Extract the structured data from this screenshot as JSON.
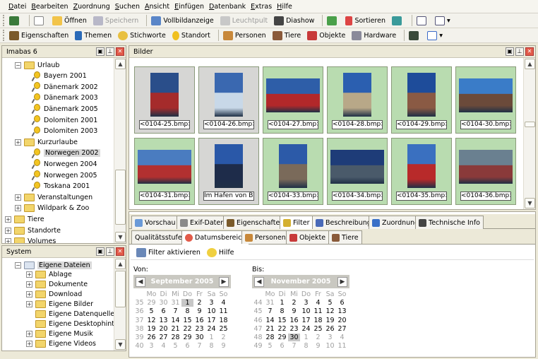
{
  "menu": [
    "Datei",
    "Bearbeiten",
    "Zuordnung",
    "Suchen",
    "Ansicht",
    "Einfügen",
    "Datenbank",
    "Extras",
    "Hilfe"
  ],
  "toolbar1": {
    "open": "Öffnen",
    "save": "Speichern",
    "fullscreen": "Vollbildanzeige",
    "lighttable": "Leuchtpult",
    "slideshow": "Diashow",
    "sort": "Sortieren"
  },
  "toolbar2": {
    "properties": "Eigenschaften",
    "topics": "Themen",
    "keywords": "Stichworte",
    "location": "Standort",
    "people": "Personen",
    "animals": "Tiere",
    "objects": "Objekte",
    "hardware": "Hardware"
  },
  "left_top": {
    "title": "Imabas 6",
    "items": [
      {
        "label": "Urlaub",
        "type": "folder",
        "expand": "−"
      },
      {
        "label": "Bayern 2001",
        "type": "pin"
      },
      {
        "label": "Dänemark 2002",
        "type": "pin"
      },
      {
        "label": "Dänemark 2003",
        "type": "pin"
      },
      {
        "label": "Dänemark 2005",
        "type": "pin"
      },
      {
        "label": "Dolomiten 2001",
        "type": "pin"
      },
      {
        "label": "Dolomiten 2003",
        "type": "pin"
      },
      {
        "label": "Kurzurlaube",
        "type": "folder",
        "expand": "+"
      },
      {
        "label": "Norwegen 2002",
        "type": "pin",
        "selected": true
      },
      {
        "label": "Norwegen 2004",
        "type": "pin"
      },
      {
        "label": "Norwegen 2005",
        "type": "pin"
      },
      {
        "label": "Toskana 2001",
        "type": "pin"
      },
      {
        "label": "Veranstaltungen",
        "type": "folder",
        "expand": "+"
      },
      {
        "label": "Wildpark & Zoo",
        "type": "folder",
        "expand": "+"
      },
      {
        "label": "Tiere",
        "type": "folder",
        "expand": "+"
      },
      {
        "label": "Standorte",
        "type": "folder",
        "expand": "+"
      },
      {
        "label": "Volumes",
        "type": "folder",
        "expand": "+"
      }
    ]
  },
  "left_bottom": {
    "title": "System",
    "items": [
      {
        "label": "Eigene Dateien",
        "expand": "−",
        "selected": true
      },
      {
        "label": "Ablage",
        "expand": "+"
      },
      {
        "label": "Dokumente",
        "expand": "+"
      },
      {
        "label": "Download",
        "expand": "+"
      },
      {
        "label": "Eigene Bilder",
        "expand": "+"
      },
      {
        "label": "Eigene Datenquellen",
        "expand": ""
      },
      {
        "label": "Eigene Desktophintergrü",
        "expand": ""
      },
      {
        "label": "Eigene Musik",
        "expand": "+"
      },
      {
        "label": "Eigene Videos",
        "expand": "+"
      }
    ]
  },
  "images": {
    "title": "Bilder",
    "tiles": [
      {
        "caption": "<0104-25.bmp>",
        "bg": "y",
        "shape": "portrait",
        "colors": [
          "#2a4e8a",
          "#a52b2b"
        ]
      },
      {
        "caption": "<0104-26.bmp>",
        "bg": "y",
        "shape": "portrait",
        "colors": [
          "#3a68b0",
          "#c8d8e8"
        ]
      },
      {
        "caption": "<0104-27.bmp>",
        "bg": "g",
        "shape": "landscape",
        "colors": [
          "#2e5ea8",
          "#b2282a"
        ]
      },
      {
        "caption": "<0104-28.bmp>",
        "bg": "g",
        "shape": "portrait",
        "colors": [
          "#2b5fb0",
          "#b8a888"
        ]
      },
      {
        "caption": "<0104-29.bmp>",
        "bg": "g",
        "shape": "portrait",
        "colors": [
          "#1e4c9a",
          "#8a5a44"
        ]
      },
      {
        "caption": "<0104-30.bmp>",
        "bg": "g",
        "shape": "landscape",
        "colors": [
          "#3a7cc8",
          "#6b4a3a"
        ]
      },
      {
        "caption": "<0104-31.bmp>",
        "bg": "g",
        "shape": "landscape",
        "colors": [
          "#4a7cc0",
          "#b23030"
        ]
      },
      {
        "caption": "Im Hafen von Bud",
        "bg": "y",
        "shape": "portrait",
        "colors": [
          "#2a58a8",
          "#1e2c4a"
        ]
      },
      {
        "caption": "<0104-33.bmp>",
        "bg": "g",
        "shape": "portrait",
        "colors": [
          "#2c5aa8",
          "#7a6a5a"
        ]
      },
      {
        "caption": "<0104-34.bmp>",
        "bg": "g",
        "shape": "landscape",
        "colors": [
          "#1e3c78",
          "#4a5a6a"
        ]
      },
      {
        "caption": "<0104-35.bmp>",
        "bg": "g",
        "shape": "portrait",
        "colors": [
          "#3a70c0",
          "#b82a2a"
        ]
      },
      {
        "caption": "<0104-36.bmp>",
        "bg": "g",
        "shape": "landscape",
        "colors": [
          "#6a8090",
          "#8a3a3a"
        ]
      }
    ]
  },
  "detail_tabs": [
    "Vorschau",
    "Exif-Daten",
    "Eigenschaften",
    "Filter",
    "Beschreibung",
    "Zuordnung",
    "Technische Info"
  ],
  "filter_tabs": [
    "Qualitätsstufen",
    "Datumsbereich",
    "Personen",
    "Objekte",
    "Tiere"
  ],
  "filter_toolbar": {
    "activate": "Filter aktivieren",
    "help": "Hilfe"
  },
  "date_range": {
    "from_label": "Von:",
    "to_label": "Bis:",
    "weekdays": [
      "Mo",
      "Di",
      "Mi",
      "Do",
      "Fr",
      "Sa",
      "So"
    ],
    "from": {
      "month": "September 2005",
      "weeks": [
        {
          "wk": "35",
          "days": [
            "29",
            "30",
            "31",
            "1",
            "2",
            "3",
            "4"
          ],
          "other": [
            0,
            1,
            2
          ],
          "today": 3
        },
        {
          "wk": "36",
          "days": [
            "5",
            "6",
            "7",
            "8",
            "9",
            "10",
            "11"
          ]
        },
        {
          "wk": "37",
          "days": [
            "12",
            "13",
            "14",
            "15",
            "16",
            "17",
            "18"
          ]
        },
        {
          "wk": "38",
          "days": [
            "19",
            "20",
            "21",
            "22",
            "23",
            "24",
            "25"
          ]
        },
        {
          "wk": "39",
          "days": [
            "26",
            "27",
            "28",
            "29",
            "30",
            "1",
            "2"
          ],
          "other": [
            5,
            6
          ]
        },
        {
          "wk": "40",
          "days": [
            "3",
            "4",
            "5",
            "6",
            "7",
            "8",
            "9"
          ],
          "other": [
            0,
            1,
            2,
            3,
            4,
            5,
            6
          ]
        }
      ]
    },
    "to": {
      "month": "November 2005",
      "weeks": [
        {
          "wk": "44",
          "days": [
            "31",
            "1",
            "2",
            "3",
            "4",
            "5",
            "6"
          ],
          "other": [
            0
          ]
        },
        {
          "wk": "45",
          "days": [
            "7",
            "8",
            "9",
            "10",
            "11",
            "12",
            "13"
          ]
        },
        {
          "wk": "46",
          "days": [
            "14",
            "15",
            "16",
            "17",
            "18",
            "19",
            "20"
          ]
        },
        {
          "wk": "47",
          "days": [
            "21",
            "22",
            "23",
            "24",
            "25",
            "26",
            "27"
          ]
        },
        {
          "wk": "48",
          "days": [
            "28",
            "29",
            "30",
            "1",
            "2",
            "3",
            "4"
          ],
          "other": [
            3,
            4,
            5,
            6
          ],
          "today": 2
        },
        {
          "wk": "49",
          "days": [
            "5",
            "6",
            "7",
            "8",
            "9",
            "10",
            "11"
          ],
          "other": [
            0,
            1,
            2,
            3,
            4,
            5,
            6
          ]
        }
      ]
    }
  }
}
